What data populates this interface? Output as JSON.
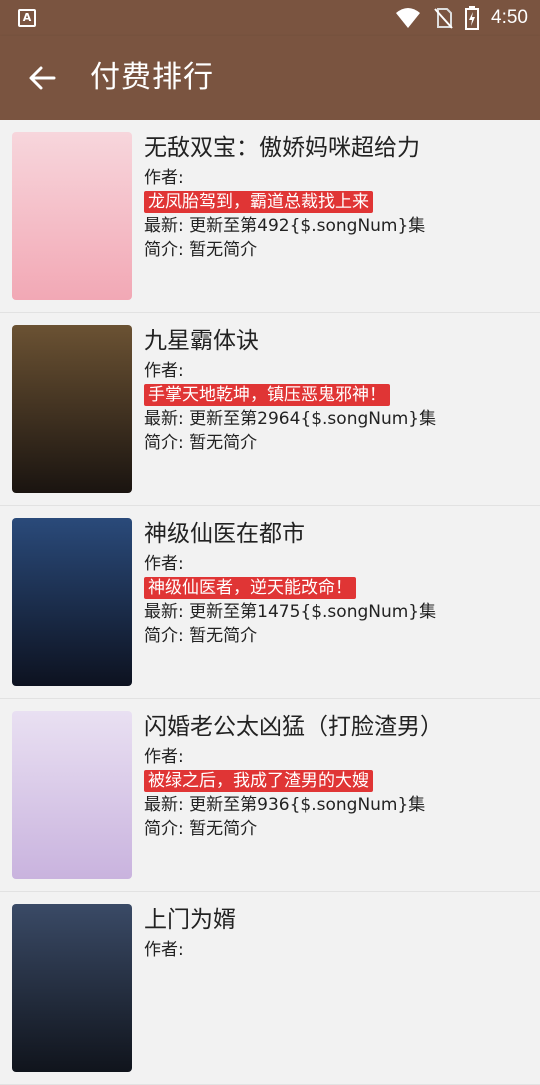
{
  "status_bar": {
    "app_letter": "A",
    "time": "4:50"
  },
  "app_bar": {
    "title": "付费排行"
  },
  "books": [
    {
      "title": "无敌双宝：傲娇妈咪超给力",
      "author_label": "作者:",
      "tagline": "龙凤胎驾到，霸道总裁找上来",
      "latest": "最新: 更新至第492{$.songNum}集",
      "intro": "简介: 暂无简介",
      "cover": {
        "top": "#f7d6dc",
        "bottom": "#f2a8b5",
        "text_color": "#b3243a"
      }
    },
    {
      "title": "九星霸体诀",
      "author_label": "作者:",
      "tagline": "手掌天地乾坤，镇压恶鬼邪神！",
      "latest": "最新: 更新至第2964{$.songNum}集",
      "intro": "简介: 暂无简介",
      "cover": {
        "top": "#6b5233",
        "bottom": "#1a1410",
        "text_color": "#ffffff"
      }
    },
    {
      "title": "神级仙医在都市",
      "author_label": "作者:",
      "tagline": "神级仙医者，逆天能改命！",
      "latest": "最新: 更新至第1475{$.songNum}集",
      "intro": "简介: 暂无简介",
      "cover": {
        "top": "#2a4a7a",
        "bottom": "#0d1220",
        "text_color": "#ffffff"
      }
    },
    {
      "title": "闪婚老公太凶猛（打脸渣男）",
      "author_label": "作者:",
      "tagline": "被绿之后，我成了渣男的大嫂",
      "latest": "最新: 更新至第936{$.songNum}集",
      "intro": "简介: 暂无简介",
      "cover": {
        "top": "#e9e0f2",
        "bottom": "#c9b3de",
        "text_color": "#9b1a5a"
      }
    },
    {
      "title": "上门为婿",
      "author_label": "作者:",
      "tagline": "",
      "latest": "",
      "intro": "",
      "cover": {
        "top": "#3a4a66",
        "bottom": "#10141c",
        "text_color": "#ffffff"
      }
    }
  ]
}
